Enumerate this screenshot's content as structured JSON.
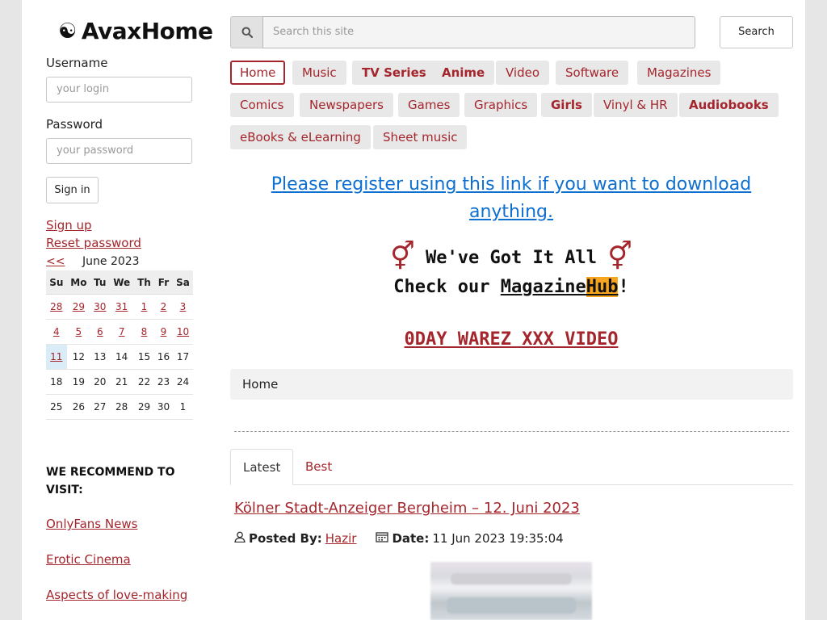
{
  "site": {
    "logo_icon": "yin-yang-icon",
    "logo_glyph": "☯",
    "name": "AvaxHome"
  },
  "login": {
    "username_label": "Username",
    "username_placeholder": "your login",
    "password_label": "Password",
    "password_placeholder": "your password",
    "sign_in": "Sign in",
    "sign_up": "Sign up",
    "reset_password": "Reset password"
  },
  "calendar": {
    "prev": "<<",
    "month": "June 2023",
    "weekdays": [
      "Su",
      "Mo",
      "Tu",
      "We",
      "Th",
      "Fr",
      "Sa"
    ],
    "weeks": [
      [
        "28",
        "29",
        "30",
        "31",
        "1",
        "2",
        "3"
      ],
      [
        "4",
        "5",
        "6",
        "7",
        "8",
        "9",
        "10"
      ],
      [
        "11",
        "12",
        "13",
        "14",
        "15",
        "16",
        "17"
      ],
      [
        "18",
        "19",
        "20",
        "21",
        "22",
        "23",
        "24"
      ],
      [
        "25",
        "26",
        "27",
        "28",
        "29",
        "30",
        "1"
      ]
    ],
    "linked_weeks": 2,
    "today": "11"
  },
  "recommend": {
    "heading": "WE RECOMMEND TO VISIT:",
    "links": [
      "OnlyFans News",
      "Erotic Cinema",
      "Aspects of love-making"
    ]
  },
  "search": {
    "placeholder": "Search this site",
    "button": "Search",
    "icon": "search-icon"
  },
  "nav": [
    {
      "label": "Home",
      "active": true
    },
    {
      "label": "Music"
    },
    {
      "label": "TV Series",
      "bold": true
    },
    {
      "label": "Anime",
      "bold": true
    },
    {
      "label": "Video"
    },
    {
      "label": "Software"
    },
    {
      "label": "Magazines"
    },
    {
      "label": "Comics"
    },
    {
      "label": "Newspapers"
    },
    {
      "label": "Games"
    },
    {
      "label": "Graphics"
    },
    {
      "label": "Girls",
      "bold": true
    },
    {
      "label": "Vinyl & HR"
    },
    {
      "label": "Audiobooks",
      "bold": true
    },
    {
      "label": "eBooks & eLearning"
    },
    {
      "label": "Sheet music"
    }
  ],
  "promo": {
    "register": "Please register using this link if you want to download anything.",
    "symbol": "⚥",
    "got_it_all": "We've Got It All",
    "check_our": "Check our ",
    "magazine": "Magazine",
    "hub": "Hub",
    "exclaim": "!",
    "warez": "0DAY WAREZ XXX VIDEO"
  },
  "breadcrumb": "Home",
  "tabs": [
    "Latest",
    "Best"
  ],
  "post": {
    "title": "Kölner Stadt-Anzeiger Bergheim – 12. Juni 2023",
    "posted_by_label": "Posted By:",
    "author": "Hazir",
    "date_label": "Date:",
    "date": "11 Jun 2023 19:35:04"
  },
  "colors": {
    "accent": "#a4262c",
    "link_blue": "#0d6fcf",
    "hub_orange": "#f7a51e"
  }
}
